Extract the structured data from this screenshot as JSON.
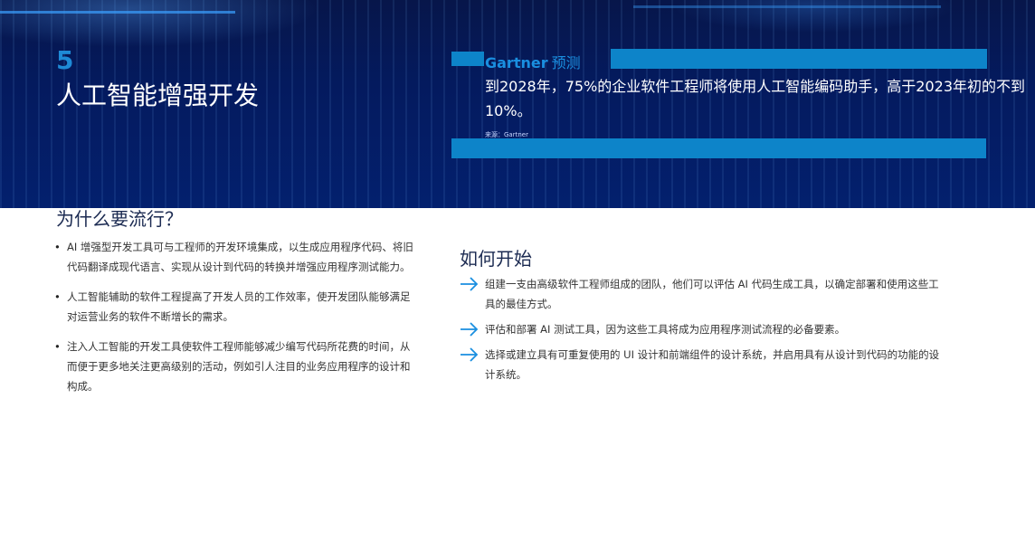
{
  "header": {
    "section_number": "5",
    "title": "人工智能增强开发"
  },
  "gartner": {
    "brand": "Gartner",
    "label": "预测",
    "quote": "到2028年，75%的企业软件工程师将使用人工智能编码助手，高于2023年初的不到10%。",
    "source": "来源：Gartner"
  },
  "why": {
    "title": "为什么要流行？",
    "items": [
      "AI 增强型开发工具可与工程师的开发环境集成，以生成应用程序代码、将旧代码翻译成现代语言、实现从设计到代码的转换并增强应用程序测试能力。",
      "人工智能辅助的软件工程提高了开发人员的工作效率，使开发团队能够满足对运营业务的软件不断增长的需求。",
      "注入人工智能的开发工具使软件工程师能够减少编写代码所花费的时间，从而便于更多地关注更高级别的活动，例如引人注目的业务应用程序的设计和构成。"
    ]
  },
  "how": {
    "title": "如何开始",
    "items": [
      "组建一支由高级软件工程师组成的团队，他们可以评估 AI 代码生成工具，以确定部署和使用这些工具的最佳方式。",
      "评估和部署 AI 测试工具，因为这些工具将成为应用程序测试流程的必备要素。",
      "选择或建立具有可重复使用的 UI 设计和前端组件的设计系统，并启用具有从设计到代码的功能的设计系统。"
    ]
  },
  "colors": {
    "accent": "#0d84c9",
    "hero_bg": "#041a5e",
    "arrow": "#1a8fe0"
  },
  "icons": {
    "how_bullet": "arrow-right-icon"
  }
}
